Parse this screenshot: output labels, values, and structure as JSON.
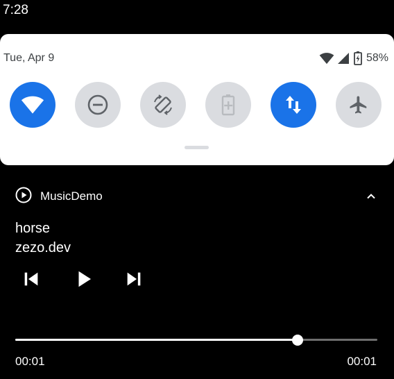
{
  "status_bar": {
    "time": "7:28"
  },
  "quick_settings": {
    "date": "Tue, Apr 9",
    "battery_percent": "58%",
    "status_icons": [
      "wifi-icon",
      "cellular-signal-icon",
      "battery-charging-icon"
    ],
    "tiles": [
      {
        "name": "wifi",
        "icon": "wifi-icon",
        "state": "on"
      },
      {
        "name": "do-not-disturb",
        "icon": "do-not-disturb-icon",
        "state": "off"
      },
      {
        "name": "auto-rotate",
        "icon": "auto-rotate-icon",
        "state": "off"
      },
      {
        "name": "battery-saver",
        "icon": "battery-saver-icon",
        "state": "off"
      },
      {
        "name": "mobile-data",
        "icon": "mobile-data-icon",
        "state": "on"
      },
      {
        "name": "airplane-mode",
        "icon": "airplane-icon",
        "state": "off"
      }
    ],
    "colors": {
      "active_tile": "#1a73e8",
      "inactive_tile": "#dadce0",
      "inactive_icon": "#5f6368"
    }
  },
  "media": {
    "app_name": "MusicDemo",
    "app_icon": "play-circle-icon",
    "title": "horse",
    "artist": "zezo.dev",
    "controls": [
      "skip-previous-icon",
      "play-icon",
      "skip-next-icon"
    ],
    "elapsed": "00:01",
    "duration": "00:01",
    "progress_fraction": 0.78
  }
}
